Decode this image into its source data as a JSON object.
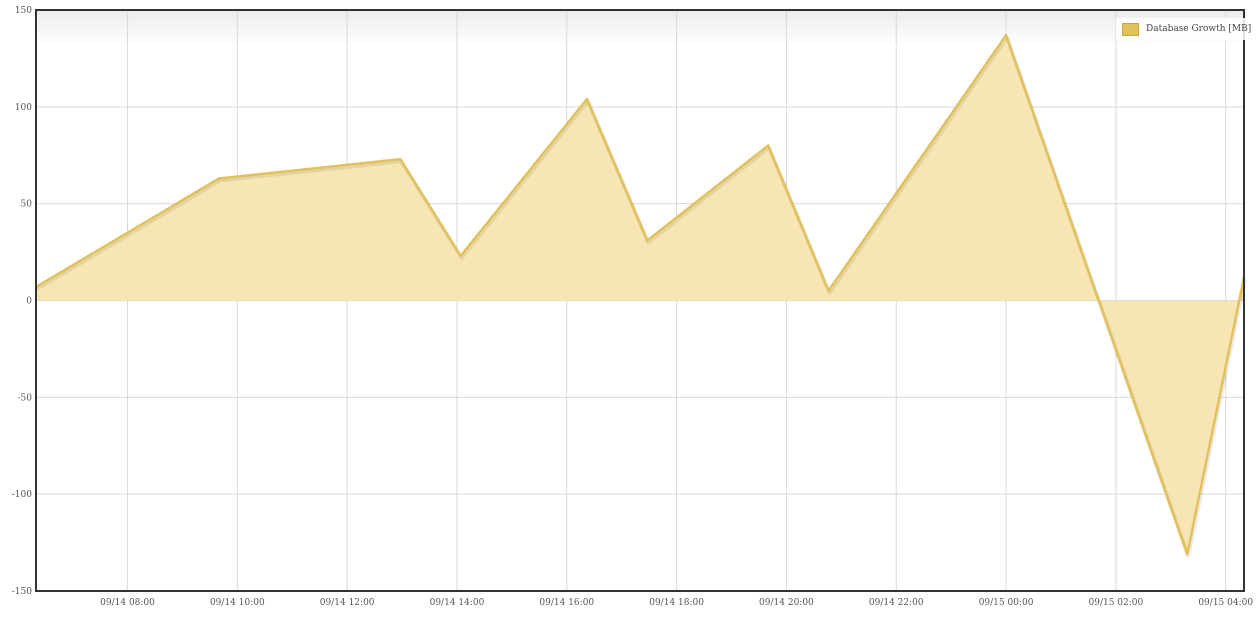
{
  "colors": {
    "series_line": "#e3c15a",
    "series_fill": "#f7e5b0",
    "grid": "#d9d9d9",
    "axis": "#333333"
  },
  "chart_data": {
    "type": "area",
    "title": "",
    "xlabel": "",
    "ylabel": "",
    "ylim": [
      -150,
      150
    ],
    "y_ticks": [
      150,
      100,
      50,
      0,
      -50,
      -100,
      -150
    ],
    "x_range": [
      "09/14 06:20",
      "09/15 04:20"
    ],
    "x_ticks": [
      "09/14 08:00",
      "09/14 10:00",
      "09/14 12:00",
      "09/14 14:00",
      "09/14 16:00",
      "09/14 18:00",
      "09/14 20:00",
      "09/14 22:00",
      "09/15 00:00",
      "09/15 02:00",
      "09/15 04:00"
    ],
    "grid": true,
    "legend_position": "top-right",
    "series": [
      {
        "name": "Database Growth [MB]",
        "x": [
          "09/14 06:20",
          "09/14 09:40",
          "09/14 12:58",
          "09/14 14:04",
          "09/14 16:22",
          "09/14 17:28",
          "09/14 19:40",
          "09/14 20:46",
          "09/15 00:00",
          "09/15 03:18",
          "09/15 04:20"
        ],
        "values": [
          7,
          63,
          73,
          23,
          104,
          31,
          80,
          5,
          137,
          -131,
          12
        ]
      }
    ]
  }
}
